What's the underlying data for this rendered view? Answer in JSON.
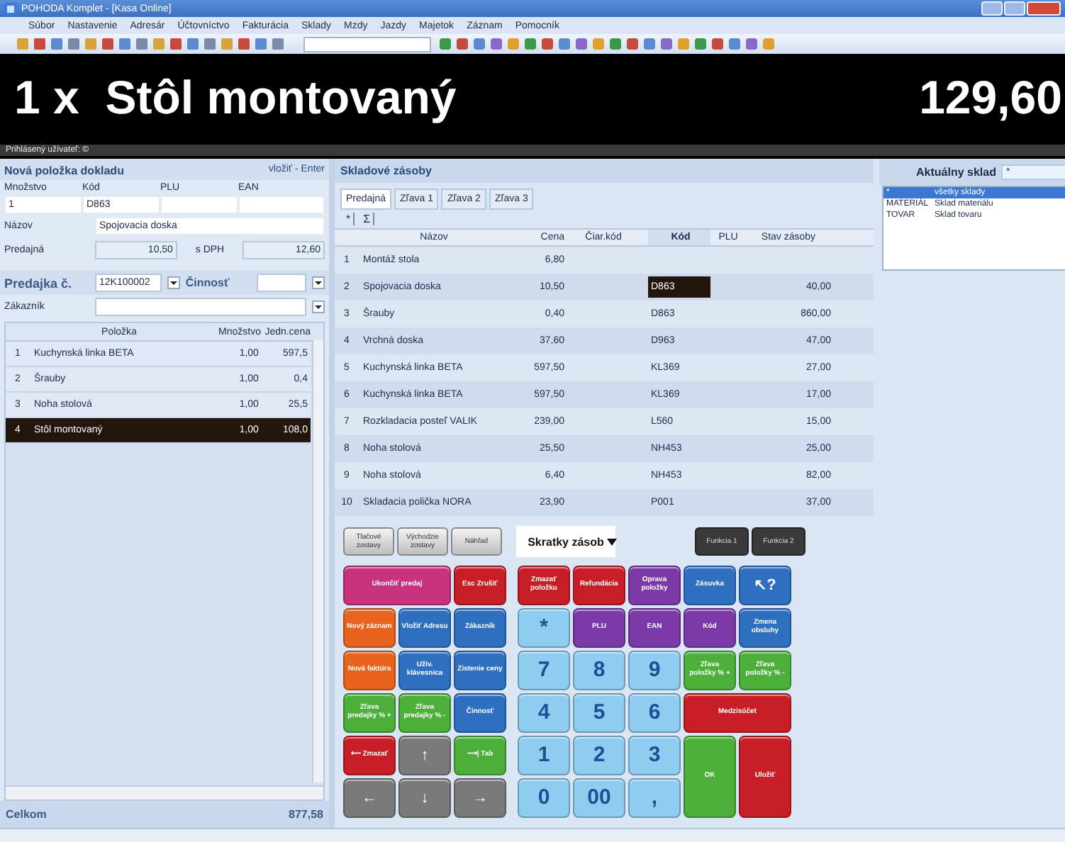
{
  "window": {
    "title": "POHODA Komplet - [Kasa Online]"
  },
  "menu": [
    "Súbor",
    "Nastavenie",
    "Adresár",
    "Účtovníctvo",
    "Fakturácia",
    "Sklady",
    "Mzdy",
    "Jazdy",
    "Majetok",
    "Záznam",
    "Pomocník"
  ],
  "banner": {
    "item": "1 x  Stôl montovaný",
    "price": "129,60"
  },
  "user_bar": "Prihlásený užívateľ: ©",
  "new_item": {
    "title": "Nová položka dokladu",
    "hint": "vložiť - Enter",
    "fields": [
      {
        "label": "Množstvo",
        "value": "1"
      },
      {
        "label": "Kód",
        "value": "D863"
      },
      {
        "label": "PLU"
      },
      {
        "label": "EAN"
      }
    ],
    "name_label": "Názov",
    "name": "Spojovacia doska",
    "price_label": "Predajná",
    "price": "10,50",
    "vat_label": "s DPH",
    "price_vat": "12,60"
  },
  "receipt": {
    "label": "Predajka č.",
    "number": "12K100002",
    "activity_label": "Činnosť",
    "customer_label": "Zákazník",
    "columns": [
      "Položka",
      "Množstvo",
      "Jedn.cena"
    ],
    "rows": [
      {
        "no": "1",
        "item": "Kuchynská linka BETA",
        "qty": "1,00",
        "price": "597,5",
        "selected": false
      },
      {
        "no": "2",
        "item": "Šrauby",
        "qty": "1,00",
        "price": "0,4",
        "selected": false
      },
      {
        "no": "3",
        "item": "Noha stolová",
        "qty": "1,00",
        "price": "25,5",
        "selected": false
      },
      {
        "no": "4",
        "item": "Stôl montovaný",
        "qty": "1,00",
        "price": "108,0",
        "selected": true
      }
    ],
    "total_label": "Celkom",
    "total": "877,58"
  },
  "stock": {
    "title": "Skladové zásoby",
    "tabs": [
      {
        "label": "Predajná",
        "selected": true
      },
      {
        "label": "Zľava 1",
        "selected": false
      },
      {
        "label": "Zľava 2",
        "selected": false
      },
      {
        "label": "Zľava 3",
        "selected": false
      }
    ],
    "tools": [
      "*",
      "Σ"
    ],
    "columns": [
      {
        "label": "Názov",
        "sorted": false
      },
      {
        "label": "Cena",
        "sorted": false
      },
      {
        "label": "Čiar.kód",
        "sorted": false
      },
      {
        "label": "Kód",
        "sorted": true
      },
      {
        "label": "PLU",
        "sorted": false
      },
      {
        "label": "Stav zásoby",
        "sorted": false
      }
    ],
    "rows": [
      {
        "no": "1",
        "name": "Montáž stola",
        "price": "6,80",
        "selected": false
      },
      {
        "no": "2",
        "name": "Spojovacia doska",
        "price": "10,50",
        "code": "D863",
        "stock": "40,00",
        "selected": true
      },
      {
        "no": "3",
        "name": "Šrauby",
        "price": "0,40",
        "code": "D863",
        "stock": "860,00",
        "selected": false
      },
      {
        "no": "4",
        "name": "Vrchná doska",
        "price": "37,60",
        "code": "D963",
        "stock": "47,00",
        "selected": false
      },
      {
        "no": "5",
        "name": "Kuchynská linka BETA",
        "price": "597,50",
        "code": "KL369",
        "stock": "27,00",
        "selected": false
      },
      {
        "no": "6",
        "name": "Kuchynská linka BETA",
        "price": "597,50",
        "code": "KL369",
        "stock": "17,00",
        "selected": false
      },
      {
        "no": "7",
        "name": "Rozkladacia posteľ VALIK",
        "price": "239,00",
        "code": "L560",
        "stock": "15,00",
        "selected": false
      },
      {
        "no": "8",
        "name": "Noha stolová",
        "price": "25,50",
        "code": "NH453",
        "stock": "25,00",
        "selected": false
      },
      {
        "no": "9",
        "name": "Noha stolová",
        "price": "6,40",
        "code": "NH453",
        "stock": "82,00",
        "selected": false
      },
      {
        "no": "10",
        "name": "Skladacia polička NORA",
        "price": "23,90",
        "code": "P001",
        "stock": "37,00",
        "selected": false
      }
    ]
  },
  "warehouse": {
    "label": "Aktuálny sklad",
    "value": "*",
    "options": [
      {
        "code": "*",
        "name": "všetky sklady",
        "selected": true
      },
      {
        "code": "MATERIÁL",
        "name": "Sklad materiálu",
        "selected": false
      },
      {
        "code": "TOVAR",
        "name": "Sklad tovaru",
        "selected": false
      }
    ]
  },
  "shortcuts": {
    "reports": [
      "Tlačové zostavy",
      "Východzie zostavy",
      "Náhľad"
    ],
    "dropdown": "Skratky zásob",
    "functions": [
      "Funkcia 1",
      "Funkcia 2"
    ],
    "left_keys": [
      {
        "label": "Ukončiť predaj",
        "kind": "wide",
        "color": "#c8327f"
      },
      {
        "label": "Esc Zrušiť",
        "kind": "key",
        "color": "#c81e28"
      },
      {
        "label": "Nový záznam",
        "kind": "key",
        "color": "#e8641e"
      },
      {
        "label": "Vložiť Adresu",
        "kind": "key",
        "color": "#2f6fc0"
      },
      {
        "label": "Zákazník",
        "kind": "key",
        "color": "#2f6fc0"
      },
      {
        "label": "Nová faktúra",
        "kind": "key",
        "color": "#e8641e"
      },
      {
        "label": "Užív. klávesnica",
        "kind": "key",
        "color": "#2f6fc0"
      },
      {
        "label": "Zistenie ceny",
        "kind": "key",
        "color": "#2f6fc0"
      },
      {
        "label": "Zľava predajky % +",
        "kind": "key",
        "color": "#4caf3a"
      },
      {
        "label": "Zľava predajky % -",
        "kind": "key",
        "color": "#4caf3a"
      },
      {
        "label": "Činnosť",
        "kind": "key",
        "color": "#2f6fc0"
      },
      {
        "label": "⟵ Zmazať",
        "kind": "key",
        "color": "#c81e28"
      },
      {
        "label": "↑",
        "kind": "arrow",
        "color": "#7a7a7a"
      },
      {
        "label": "⟶| Tab",
        "kind": "key",
        "color": "#4caf3a"
      },
      {
        "label": "←",
        "kind": "arrow",
        "color": "#7a7a7a"
      },
      {
        "label": "↓",
        "kind": "arrow",
        "color": "#7a7a7a"
      },
      {
        "label": "→",
        "kind": "arrow",
        "color": "#7a7a7a"
      }
    ],
    "right_keys": [
      {
        "label": "Zmazať položku",
        "kind": "key",
        "color": "#c81e28"
      },
      {
        "label": "Refundácia",
        "kind": "key",
        "color": "#c81e28"
      },
      {
        "label": "Oprava položky",
        "kind": "key",
        "color": "#7b3aa8"
      },
      {
        "label": "Zásuvka",
        "kind": "key",
        "color": "#2f6fc0"
      },
      {
        "label": "↖?",
        "kind": "arrow",
        "color": "#2f6fc0"
      },
      {
        "label": "*",
        "kind": "digit",
        "color": "#8fcdf0"
      },
      {
        "label": "PLU",
        "kind": "key",
        "color": "#7b3aa8"
      },
      {
        "label": "EAN",
        "kind": "key",
        "color": "#7b3aa8"
      },
      {
        "label": "Kód",
        "kind": "key",
        "color": "#7b3aa8"
      },
      {
        "label": "Zmena obsluhy",
        "kind": "key",
        "color": "#2f6fc0"
      },
      {
        "label": "7",
        "kind": "digit",
        "color": "#8fcdf0"
      },
      {
        "label": "8",
        "kind": "digit",
        "color": "#8fcdf0"
      },
      {
        "label": "9",
        "kind": "digit",
        "color": "#8fcdf0"
      },
      {
        "label": "Zľava položky % +",
        "kind": "key",
        "color": "#4caf3a"
      },
      {
        "label": "Zľava položky % -",
        "kind": "key",
        "color": "#4caf3a"
      },
      {
        "label": "4",
        "kind": "digit",
        "color": "#8fcdf0"
      },
      {
        "label": "5",
        "kind": "digit",
        "color": "#8fcdf0"
      },
      {
        "label": "6",
        "kind": "digit",
        "color": "#8fcdf0"
      },
      {
        "label": "Medzisúčet",
        "kind": "wide",
        "color": "#c81e28"
      },
      {
        "label": "1",
        "kind": "digit",
        "color": "#8fcdf0"
      },
      {
        "label": "2",
        "kind": "digit",
        "color": "#8fcdf0"
      },
      {
        "label": "3",
        "kind": "digit",
        "color": "#8fcdf0"
      },
      {
        "label": "OK",
        "kind": "tall",
        "color": "#4caf3a"
      },
      {
        "label": "Uložiť",
        "kind": "tall",
        "color": "#c81e28"
      },
      {
        "label": "0",
        "kind": "digit",
        "color": "#8fcdf0"
      },
      {
        "label": "00",
        "kind": "digit",
        "color": "#8fcdf0"
      },
      {
        "label": ",",
        "kind": "digit",
        "color": "#8fcdf0"
      }
    ]
  }
}
